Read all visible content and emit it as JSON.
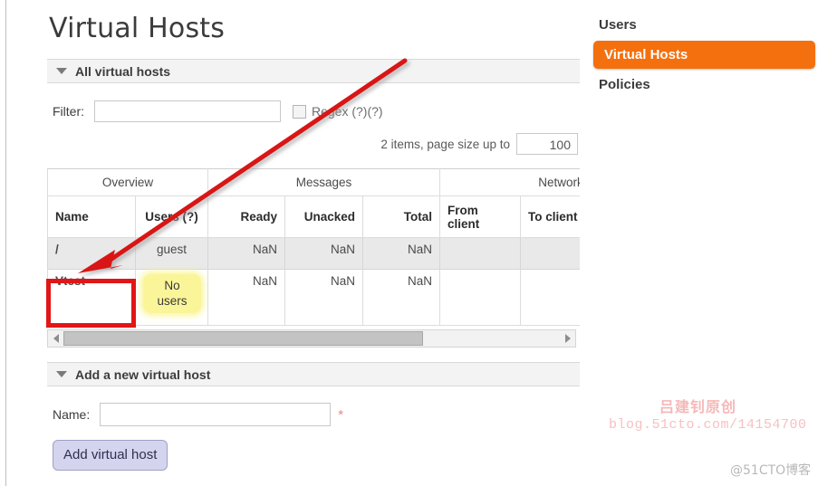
{
  "page": {
    "title": "Virtual Hosts"
  },
  "all_hosts_section": {
    "caret_icon": "caret-down-icon",
    "heading": "All virtual hosts",
    "filter": {
      "label": "Filter:",
      "value": "",
      "placeholder": ""
    },
    "regex": {
      "label": "Regex (?)(?)",
      "checked": false
    },
    "pagesize": {
      "text": "2 items, page size up to",
      "value": "100"
    }
  },
  "table": {
    "group_headers": [
      {
        "label": "Overview",
        "span": 2
      },
      {
        "label": "Messages",
        "span": 3
      },
      {
        "label": "Network",
        "span": 2
      }
    ],
    "columns": [
      {
        "label": "Name",
        "align": "left"
      },
      {
        "label": "Users (?)",
        "align": "center"
      },
      {
        "label": "Ready",
        "align": "right"
      },
      {
        "label": "Unacked",
        "align": "right"
      },
      {
        "label": "Total",
        "align": "right"
      },
      {
        "label": "From client",
        "align": "left"
      },
      {
        "label": "To client",
        "align": "left"
      }
    ],
    "rows": [
      {
        "name": "/",
        "users": "guest",
        "ready": "NaN",
        "unacked": "NaN",
        "total": "NaN",
        "from_client": "",
        "to_client": ""
      },
      {
        "name": "Vtest",
        "users": "No users",
        "ready": "NaN",
        "unacked": "NaN",
        "total": "NaN",
        "from_client": "",
        "to_client": ""
      }
    ],
    "scrollbar": {
      "left_arrow_icon": "arrow-left-icon",
      "right_arrow_icon": "arrow-right-icon"
    }
  },
  "add_section": {
    "caret_icon": "caret-down-icon",
    "heading": "Add a new virtual host",
    "name_label": "Name:",
    "name_value": "",
    "required_marker": "*",
    "submit_label": "Add virtual host"
  },
  "rightnav": {
    "items": [
      {
        "label": "Users",
        "active": false
      },
      {
        "label": "Virtual Hosts",
        "active": true
      },
      {
        "label": "Policies",
        "active": false
      }
    ]
  },
  "watermarks": {
    "author_cn": "吕建钊原创",
    "blog_url": "blog.51cto.com/14154700",
    "corner": "@51CTO博客"
  },
  "colors": {
    "accent_orange": "#f4700f",
    "annotation_red": "#e11616",
    "badge_yellow": "#fbf59a",
    "button_lavender": "#d4d4ee"
  }
}
